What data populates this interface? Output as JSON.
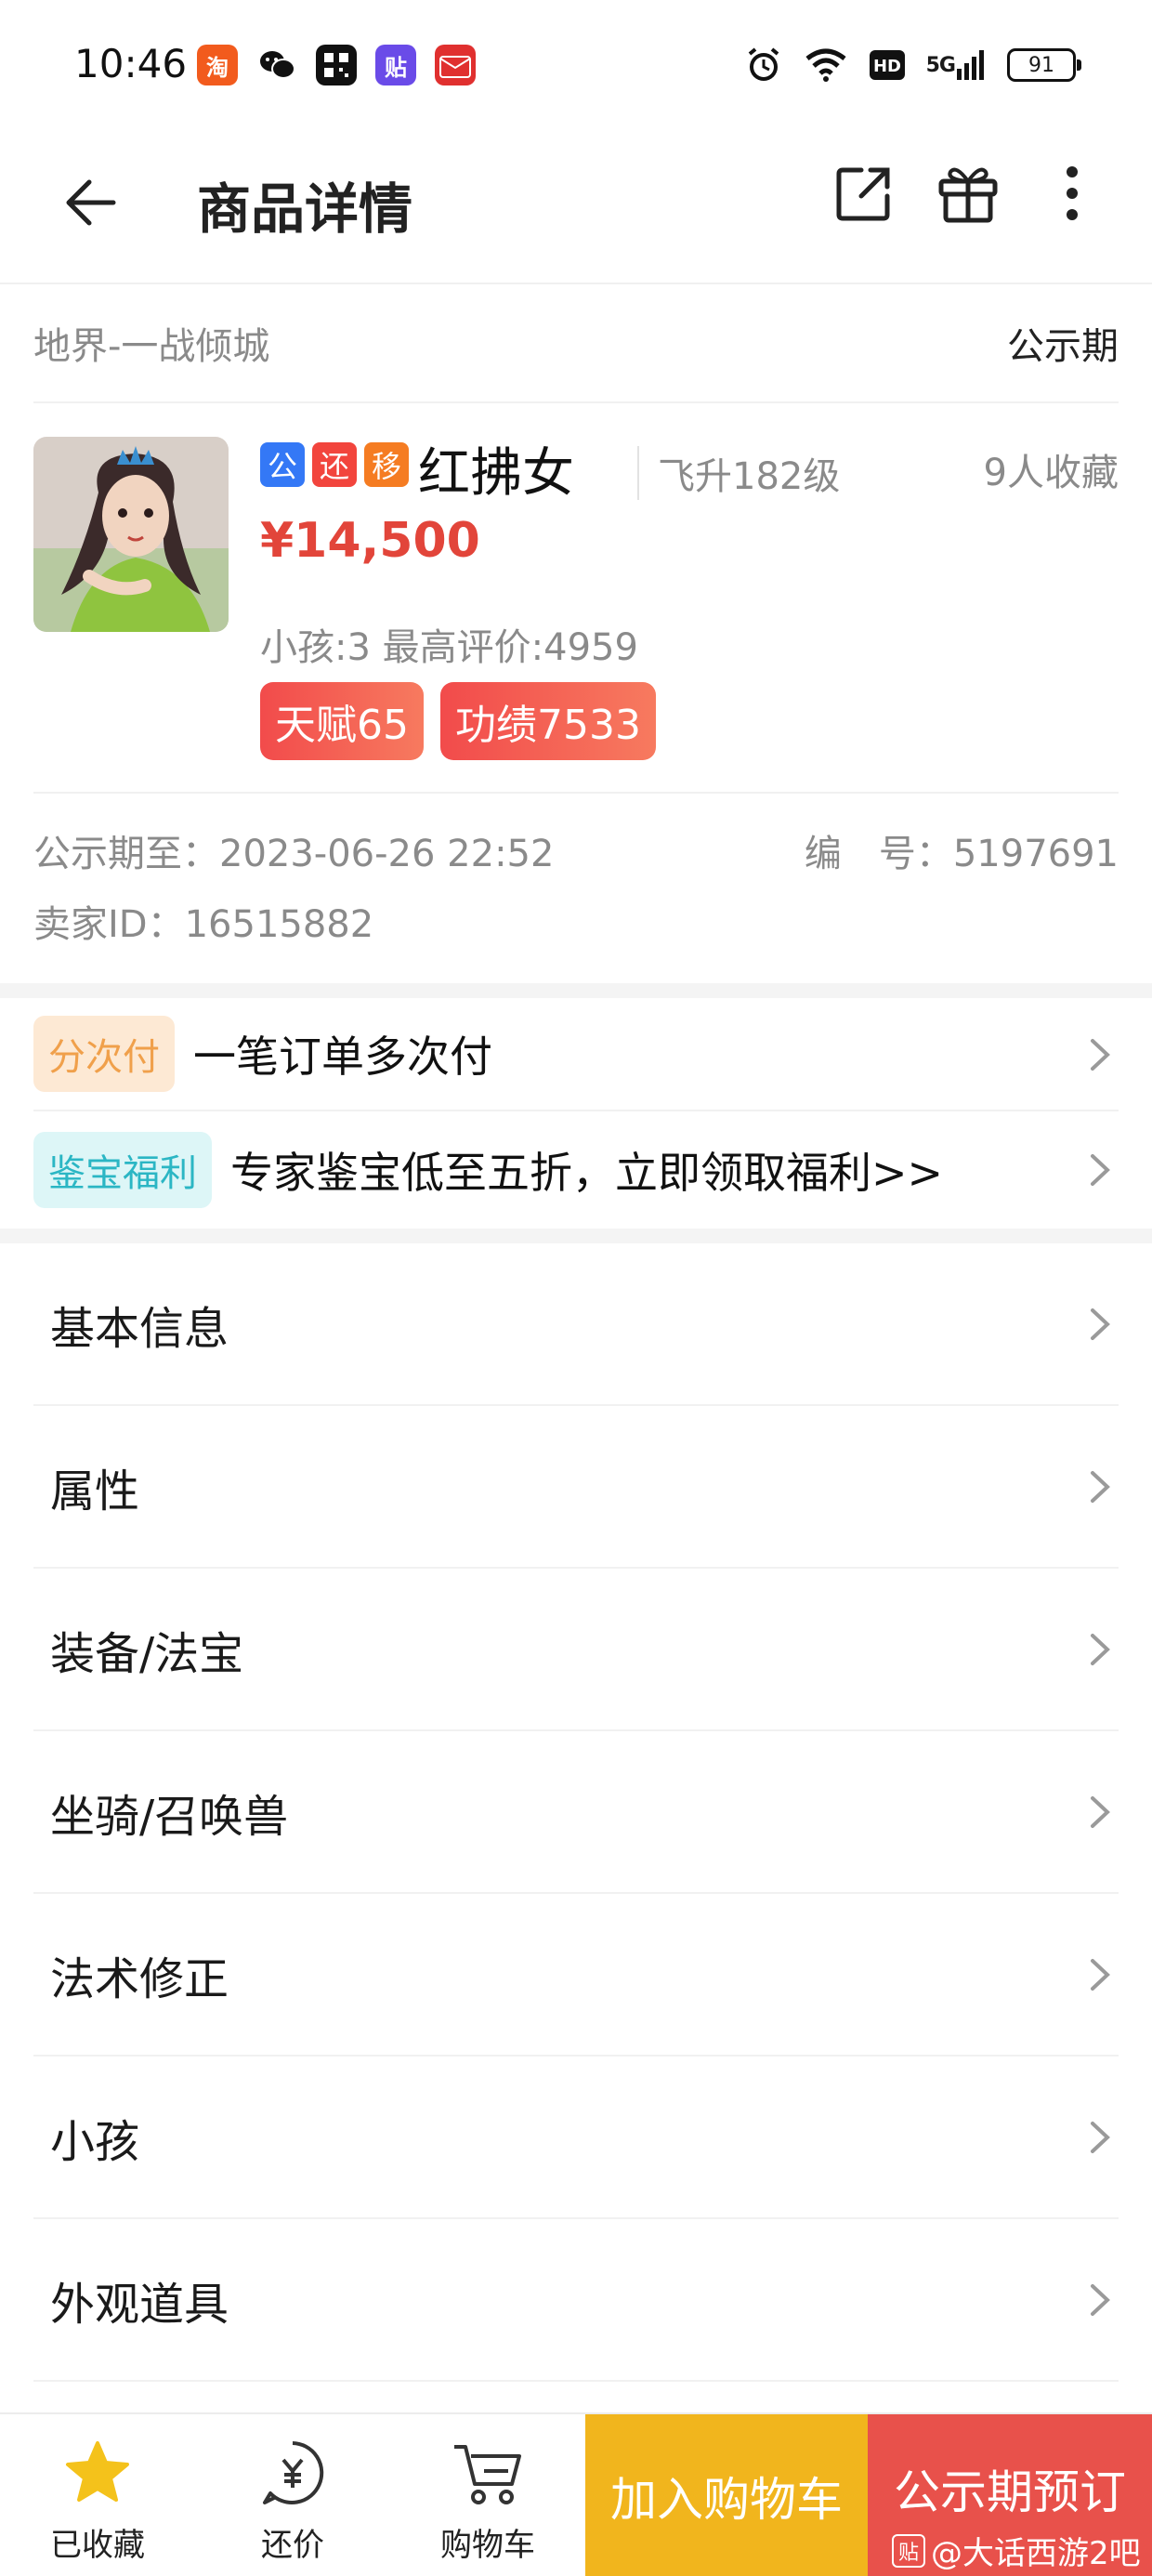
{
  "status_bar": {
    "time": "10:46",
    "battery": "91",
    "network": "5G"
  },
  "nav": {
    "title": "商品详情"
  },
  "product": {
    "server": "地界-一战倾城",
    "stage": "公示期",
    "tags": [
      {
        "text": "公",
        "color": "#3478f6"
      },
      {
        "text": "还",
        "color": "#f2453d"
      },
      {
        "text": "移",
        "color": "#f57c22"
      }
    ],
    "name": "红拂女",
    "level": "飞升182级",
    "favorites": "9人收藏",
    "price": "¥14,500",
    "sub_info": "小孩:3 最高评价:4959",
    "pills": [
      "天赋65",
      "功绩7533"
    ]
  },
  "meta": {
    "public_until": "公示期至：2023-06-26 22:52",
    "number": "编　号：5197691",
    "seller": "卖家ID：16515882"
  },
  "promos": [
    {
      "tag": "分次付",
      "text": "一笔订单多次付",
      "tag_bg": "#fde9d4",
      "tag_color": "#f0a04b"
    },
    {
      "tag": "鉴宝福利",
      "text": "专家鉴宝低至五折，立即领取福利>>",
      "tag_bg": "#ddf6f7",
      "tag_color": "#2bb6c4"
    }
  ],
  "menu": [
    "基本信息",
    "属性",
    "装备/法宝",
    "坐骑/召唤兽",
    "法术修正",
    "小孩",
    "外观道具"
  ],
  "bottom_bar": {
    "favorited": "已收藏",
    "bargain": "还价",
    "cart": "购物车",
    "add_to_cart": "加入购物车",
    "preorder": "公示期预订",
    "watermark_icon": "贴",
    "watermark_text": "@大话西游2吧"
  }
}
